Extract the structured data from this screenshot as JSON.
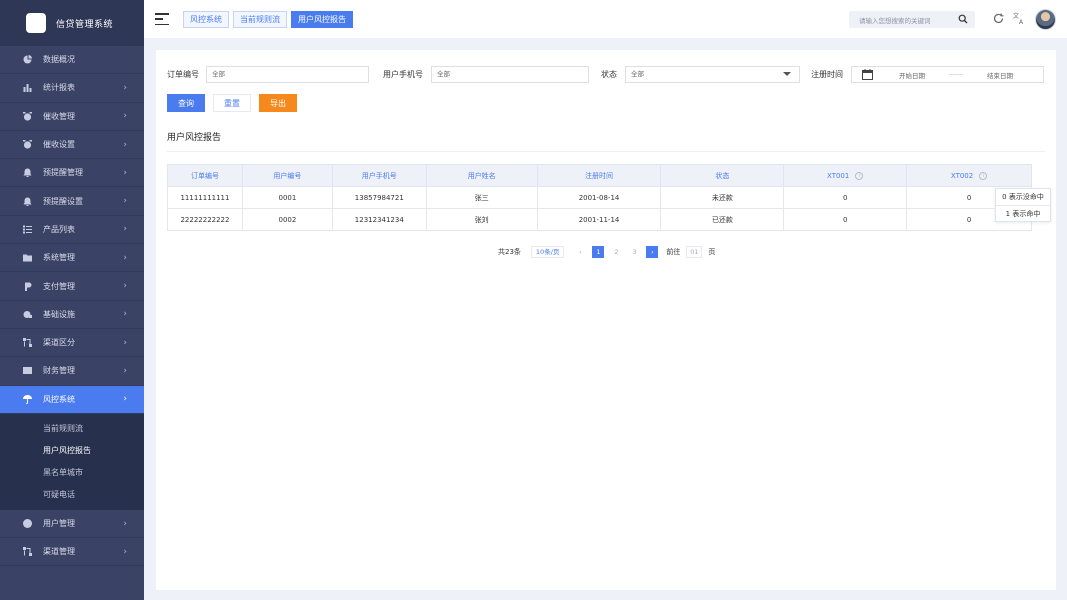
{
  "app": {
    "title": "信贷管理系统"
  },
  "sidebar": {
    "items": [
      {
        "label": "数据概况",
        "icon": "pie-chart-icon",
        "chevron": false
      },
      {
        "label": "统计报表",
        "icon": "bar-chart-icon",
        "chevron": true
      },
      {
        "label": "催收管理",
        "icon": "alarm-clock-icon",
        "chevron": true
      },
      {
        "label": "催收设置",
        "icon": "alarm-clock-icon",
        "chevron": true
      },
      {
        "label": "预提醒管理",
        "icon": "bell-icon",
        "chevron": true
      },
      {
        "label": "预提醒设置",
        "icon": "bell-icon",
        "chevron": true
      },
      {
        "label": "产品列表",
        "icon": "list-icon",
        "chevron": true
      },
      {
        "label": "系统管理",
        "icon": "folder-gear-icon",
        "chevron": true
      },
      {
        "label": "支付管理",
        "icon": "payment-icon",
        "chevron": true
      },
      {
        "label": "基础设施",
        "icon": "infrastructure-icon",
        "chevron": true
      },
      {
        "label": "渠道区分",
        "icon": "channel-icon",
        "chevron": true
      },
      {
        "label": "财务管理",
        "icon": "finance-icon",
        "chevron": true
      },
      {
        "label": "风控系统",
        "icon": "umbrella-icon",
        "chevron": true,
        "active": true
      }
    ],
    "submenu": [
      {
        "label": "当前规则流"
      },
      {
        "label": "用户风控报告",
        "active": true
      },
      {
        "label": "黑名单城市"
      },
      {
        "label": "可疑电话"
      }
    ],
    "bottom_items": [
      {
        "label": "用户管理",
        "icon": "user-icon",
        "chevron": true
      },
      {
        "label": "渠道管理",
        "icon": "channel-icon",
        "chevron": true
      }
    ]
  },
  "header": {
    "tabs": [
      {
        "label": "风控系统"
      },
      {
        "label": "当前规则流"
      },
      {
        "label": "用户风控报告",
        "active": true
      }
    ],
    "search_placeholder": "请输入您想搜索的关键词"
  },
  "filters": {
    "order_no_label": "订单编号",
    "order_no_value": "全部",
    "phone_label": "用户手机号",
    "phone_value": "全部",
    "status_label": "状态",
    "status_value": "全部",
    "reg_time_label": "注册时间",
    "start_date_placeholder": "开始日期",
    "end_date_placeholder": "结束日期"
  },
  "buttons": {
    "query": "查询",
    "reset": "重置",
    "export": "导出"
  },
  "section_title": "用户风控报告",
  "table": {
    "columns": [
      "订单编号",
      "用户编号",
      "用户手机号",
      "用户姓名",
      "注册时间",
      "状态",
      "XT001",
      "XT002"
    ],
    "rows": [
      [
        "11111111111",
        "0001",
        "13857984721",
        "张三",
        "2001-08-14",
        "未还款",
        "0",
        "0"
      ],
      [
        "22222222222",
        "0002",
        "12312341234",
        "张刘",
        "2001-11-14",
        "已还款",
        "0",
        "0"
      ]
    ]
  },
  "tooltip": {
    "line1": "0 表示没命中",
    "line2": "1 表示命中"
  },
  "pagination": {
    "total": "共23条",
    "page_size": "10条/页",
    "pages": [
      "1",
      "2",
      "3"
    ],
    "current": "1",
    "goto_label": "前往",
    "goto_value": "01",
    "page_suffix": "页"
  },
  "colors": {
    "sidebar_bg": "#3a4366",
    "accent": "#4a7cf0",
    "warn": "#f5891b"
  }
}
